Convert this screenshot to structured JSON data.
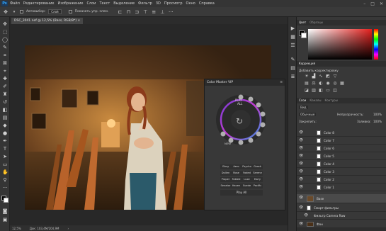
{
  "menu": [
    "Файл",
    "Редактирование",
    "Изображение",
    "Слои",
    "Текст",
    "Выделение",
    "Фильтр",
    "3D",
    "Просмотр",
    "Окно",
    "Справка"
  ],
  "options": {
    "autoselect_label": "Автовыбор:",
    "autoselect_value": "Слой",
    "transform_label": "Показать упр. элем."
  },
  "document": {
    "tab_label": "DSC_3041.nef @ 12,5% (Bass, RGB/8*) ×"
  },
  "status": {
    "zoom": "12,5%",
    "doc_size": "Док: 103,4M/204,9M"
  },
  "color_master": {
    "title": "Color Master VIP",
    "center_top": "PLAY",
    "center_bottom": "ALL",
    "modes": [
      "Glory",
      "Aero",
      "Psycho",
      "Greek",
      "Dollen",
      "Rose",
      "Faded",
      "Serene",
      "Proper",
      "Fabled",
      "Luxe",
      "Early",
      "Senator",
      "Haven",
      "Suede",
      "Pacific"
    ],
    "play_all": "Play All",
    "mini_label": "NEW"
  },
  "color_panel": {
    "tabs": [
      "Цвет",
      "Образцы"
    ]
  },
  "corrections_panel": {
    "title": "Коррекция",
    "subtitle": "Добавить корректировку"
  },
  "layers_panel": {
    "tabs": [
      "Слои",
      "Каналы",
      "Контуры"
    ],
    "kind_label": "Вид",
    "blend": "Обычные",
    "opacity_label": "Непрозрачность:",
    "opacity": "100%",
    "lock_label": "Закрепить:",
    "fill_label": "Заливка:",
    "fill": "100%",
    "layers": [
      "Color 8",
      "Color 7",
      "Color 6",
      "Color 5",
      "Color 4",
      "Color 3",
      "Color 2",
      "Color 1"
    ],
    "base_layer": "Base",
    "smart_filters": "Смарт-фильтры",
    "camera_raw": "Фильтр Camera Raw",
    "bg_layer": "Фон"
  }
}
